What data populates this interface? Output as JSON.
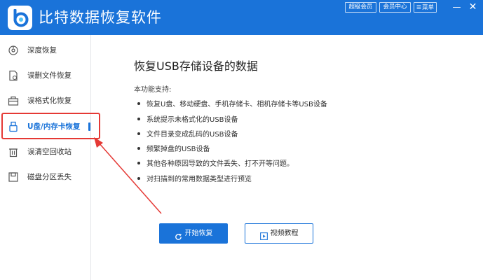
{
  "app": {
    "title": "比特数据恢复软件"
  },
  "titlebar": {
    "super_member": "超级会员",
    "member_center": "会员中心",
    "menu": "菜单"
  },
  "sidebar": {
    "items": [
      {
        "label": "深度恢复",
        "icon": "deep-scan-icon"
      },
      {
        "label": "误删文件恢复",
        "icon": "deleted-file-icon"
      },
      {
        "label": "误格式化恢复",
        "icon": "format-icon"
      },
      {
        "label": "U盘/内存卡恢复",
        "icon": "usb-drive-icon",
        "active": true
      },
      {
        "label": "误清空回收站",
        "icon": "recycle-bin-icon"
      },
      {
        "label": "磁盘分区丢失",
        "icon": "disk-partition-icon"
      }
    ]
  },
  "main": {
    "title": "恢复USB存储设备的数据",
    "subtitle": "本功能支持:",
    "features": [
      "恢复U盘、移动硬盘、手机存储卡、相机存储卡等USB设备",
      "系统提示未格式化的USB设备",
      "文件目录变成乱码的USB设备",
      "频繁掉盘的USB设备",
      "其他各种原因导致的文件丢失、打不开等问题。",
      "对扫描到的常用数据类型进行预览"
    ],
    "start_button": "开始恢复",
    "video_button": "视频教程"
  },
  "colors": {
    "accent": "#1a73d9",
    "highlight": "#e53935"
  }
}
